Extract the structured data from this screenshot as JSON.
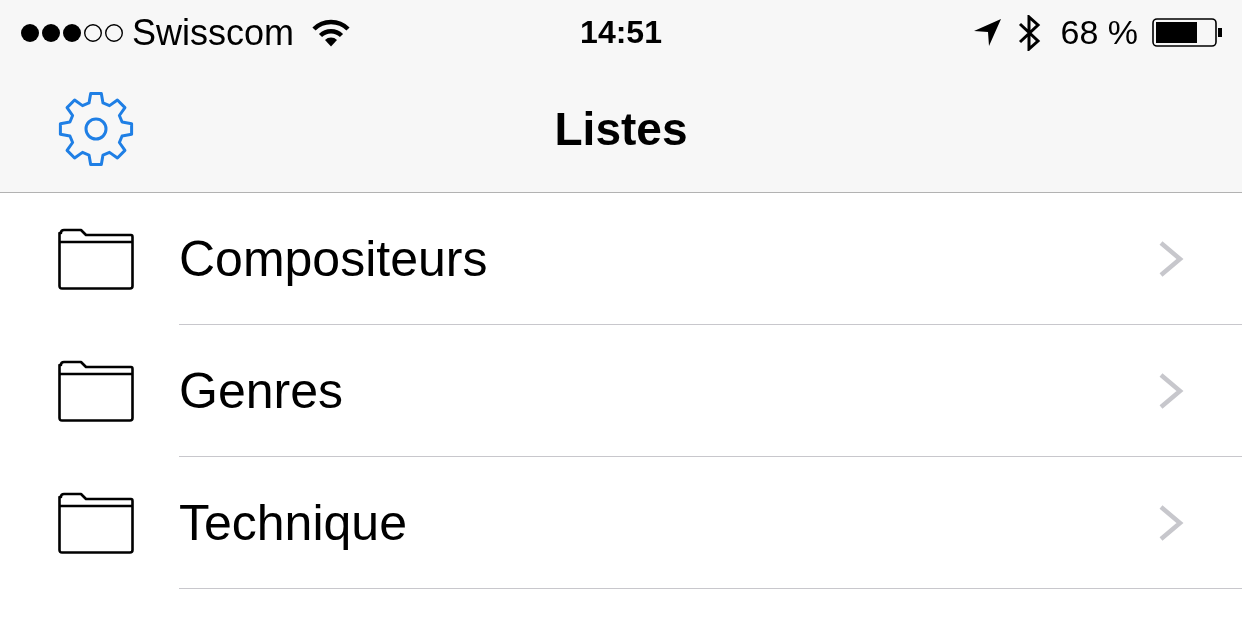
{
  "status_bar": {
    "carrier": "Swisscom",
    "time": "14:51",
    "battery_text": "68 %"
  },
  "nav_bar": {
    "title": "Listes"
  },
  "list": {
    "items": [
      {
        "label": "Compositeurs"
      },
      {
        "label": "Genres"
      },
      {
        "label": "Technique"
      }
    ]
  }
}
